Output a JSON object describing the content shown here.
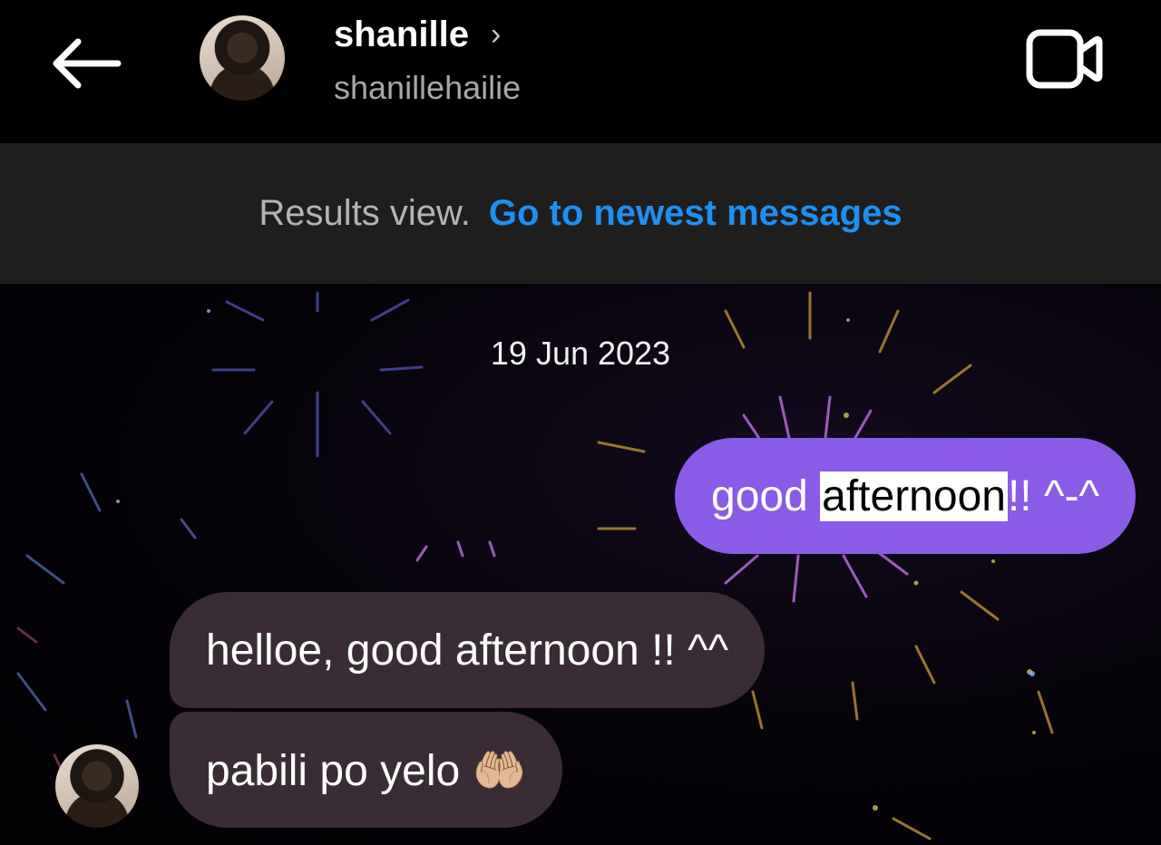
{
  "header": {
    "back_icon": "back-arrow-icon",
    "name": "shanille",
    "chevron": "›",
    "username": "shanillehailie",
    "video_icon": "video-call-icon"
  },
  "banner": {
    "label": "Results view.",
    "link": "Go to newest messages"
  },
  "chat": {
    "date": "19 Jun 2023",
    "sent_message": {
      "before": "good ",
      "highlight": "afternoon",
      "after": "!! ^-^"
    },
    "received_messages": [
      "helloe, good afternoon !! ^^",
      "pabili po yelo 🤲🏼"
    ]
  },
  "colors": {
    "sent_bubble": "#8a5be6",
    "received_bubble": "#3a2c35",
    "link": "#1f8ff2",
    "banner_bg": "#1e1e1e"
  }
}
